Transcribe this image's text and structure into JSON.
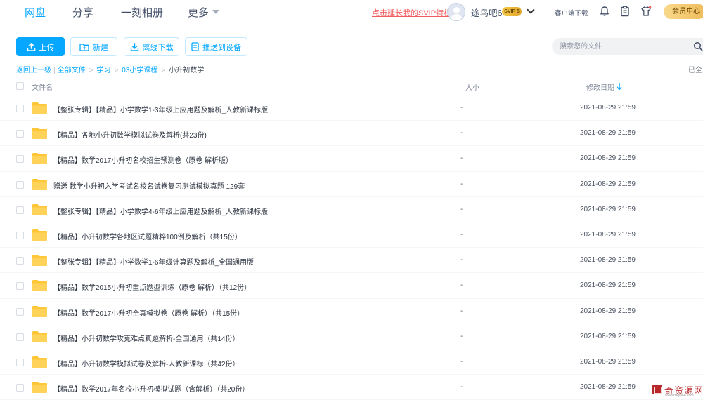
{
  "nav": {
    "tabs": [
      {
        "label": "网盘"
      },
      {
        "label": "分享"
      },
      {
        "label": "一刻相册"
      },
      {
        "label": "更多"
      }
    ],
    "svip_link": "点击延长我的SVIP特权",
    "username": "途鸟吧6",
    "vip_badge": "SVIP 5",
    "client_download": "客户端下载",
    "vip_center": "会员中心",
    "icons": [
      "bell-icon",
      "clipboard-icon",
      "tshirt-icon"
    ]
  },
  "toolbar": {
    "upload": "上传",
    "new": "新建",
    "offline_download": "离线下载",
    "push_to_device": "推送到设备",
    "search_placeholder": "搜索您的文件"
  },
  "breadcrumb": {
    "back": "返回上一级",
    "items": [
      "全部文件",
      "学习",
      "03小学课程"
    ],
    "current": "小升初数学",
    "loaded_status": "已全部加载"
  },
  "table": {
    "headers": {
      "name": "文件名",
      "size": "大小",
      "modified": "修改日期"
    },
    "sort_order": "descending",
    "rows": [
      {
        "name": "【整张专辑】【精品】小学数学1-3年级上应用题及解析_人教新课标版",
        "size": "-",
        "modified": "2021-08-29 21:59"
      },
      {
        "name": "【精品】各地小升初数学模拟试卷及解析(共23份)",
        "size": "-",
        "modified": "2021-08-29 21:59"
      },
      {
        "name": "【精品】数学2017小升初名校招生预测卷（原卷 解析版）",
        "size": "-",
        "modified": "2021-08-29 21:59"
      },
      {
        "name": "赠送 数学小升初入学考试名校名试卷复习测试模拟真题 129套",
        "size": "-",
        "modified": "2021-08-29 21:59"
      },
      {
        "name": "【整张专辑】【精品】小学数学4-6年级上应用题及解析_人教新课标版",
        "size": "-",
        "modified": "2021-08-29 21:59"
      },
      {
        "name": "【精品】小升初数学各地区试题精粹100例及解析（共15份）",
        "size": "-",
        "modified": "2021-08-29 21:59"
      },
      {
        "name": "【整张专辑】【精品】小学数学1-6年级计算题及解析_全国通用版",
        "size": "-",
        "modified": "2021-08-29 21:59"
      },
      {
        "name": "【精品】数学2015小升初重点题型训练（原卷 解析）（共12份）",
        "size": "-",
        "modified": "2021-08-29 21:59"
      },
      {
        "name": "【精品】数学2017小升初全真模拟卷（原卷 解析）（共15份）",
        "size": "-",
        "modified": "2021-08-29 21:59"
      },
      {
        "name": "【精品】小升初数学攻克难点真题解析-全国通用（共14份）",
        "size": "-",
        "modified": "2021-08-29 21:59"
      },
      {
        "name": "【精品】小升初数学模拟试卷及解析-人教新课标（共42份）",
        "size": "-",
        "modified": "2021-08-29 21:59"
      },
      {
        "name": "【精品】数学2017年名校小升初模拟试题（含解析）（共20份）",
        "size": "-",
        "modified": "2021-08-29 21:59"
      }
    ]
  },
  "watermark": {
    "text": "奇资源网",
    "url": "www.daqi666.com"
  },
  "colors": {
    "accent": "#06a7ff",
    "folder": "#ffc637",
    "svip_red": "#f25d5d",
    "gold": "#efbc5a"
  }
}
